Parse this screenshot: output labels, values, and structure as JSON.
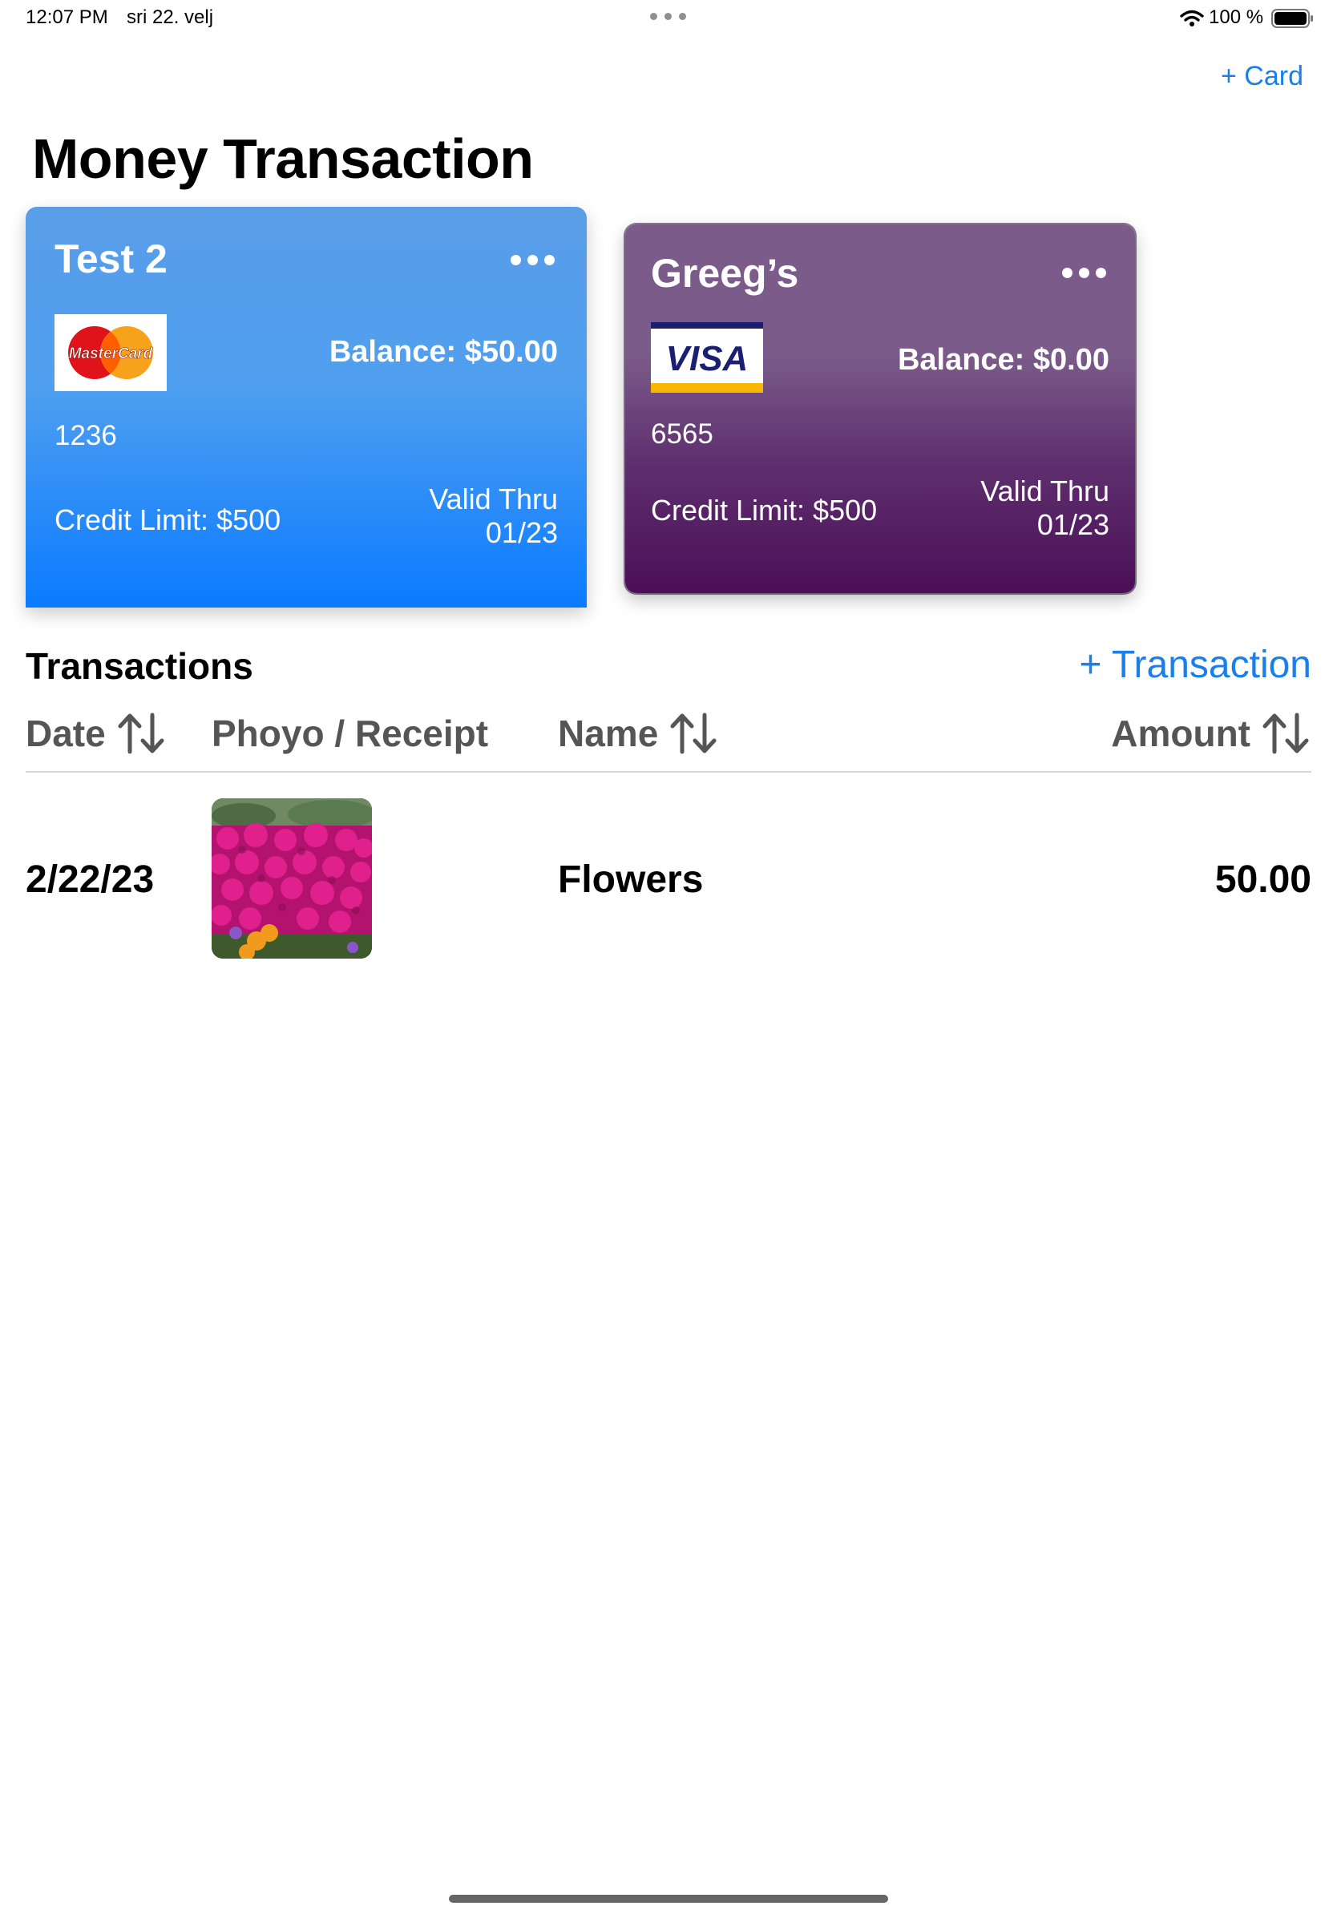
{
  "status_bar": {
    "time": "12:07 PM",
    "date": "sri 22. velj",
    "battery_text": "100 %"
  },
  "header": {
    "add_card_label": "+ Card",
    "title": "Money Transaction"
  },
  "cards": [
    {
      "name": "Test 2",
      "brand": "MasterCard",
      "balance": "Balance: $50.00",
      "number": "1236",
      "credit_limit": "Credit Limit: $500",
      "valid_label": "Valid Thru",
      "valid_date": "01/23",
      "colors": {
        "top": "#5a9ee8",
        "bottom": "#0a7bff"
      }
    },
    {
      "name": "Greeg’s",
      "brand": "VISA",
      "balance": "Balance: $0.00",
      "number": "6565",
      "credit_limit": "Credit Limit: $500",
      "valid_label": "Valid Thru",
      "valid_date": "01/23",
      "colors": {
        "top": "#7b5b8a",
        "bottom": "#4b0f58"
      }
    }
  ],
  "transactions": {
    "title": "Transactions",
    "add_label": "+ Transaction",
    "columns": {
      "date": "Date",
      "photo": "Phoyo / Receipt",
      "name": "Name",
      "amount": "Amount"
    },
    "rows": [
      {
        "date": "2/22/23",
        "name": "Flowers",
        "amount": "50.00",
        "photo_icon": "flowers-photo"
      }
    ]
  },
  "accent_color": "#1a7fe8"
}
